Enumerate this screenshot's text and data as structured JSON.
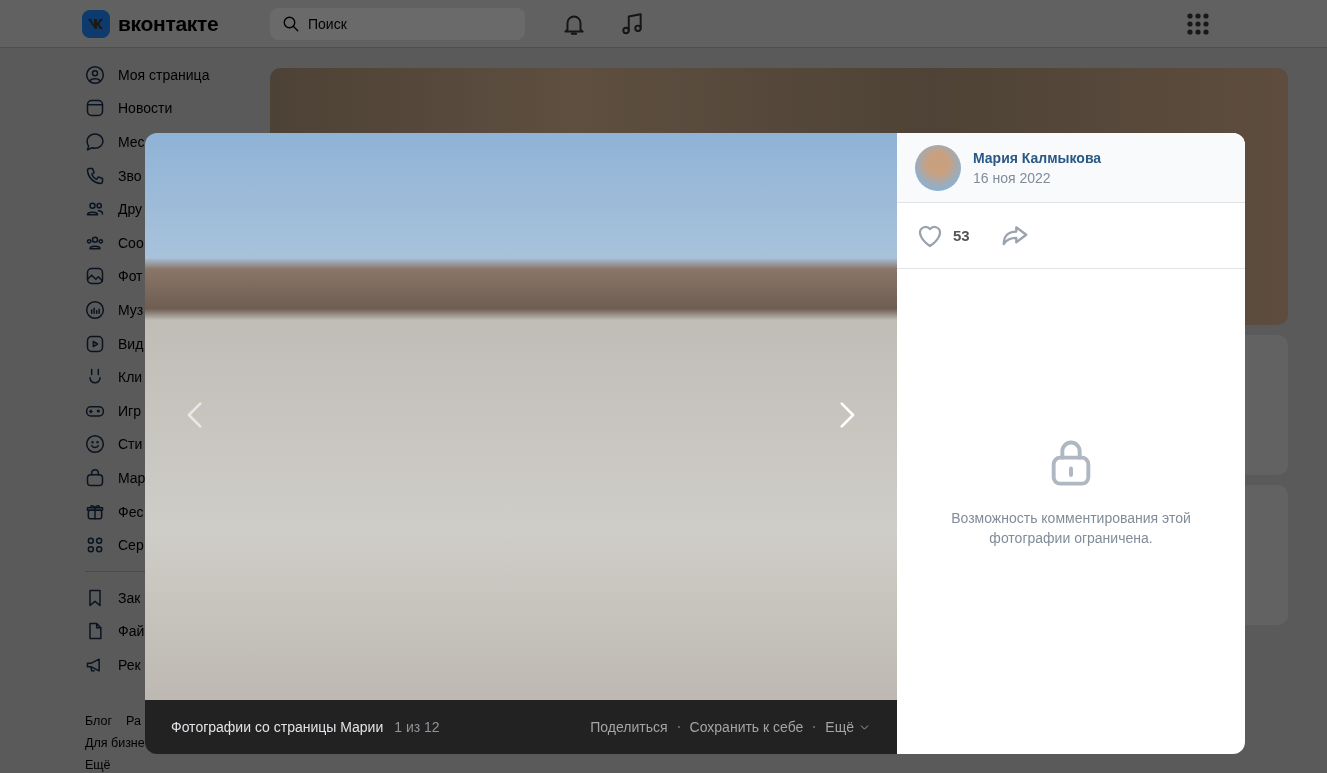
{
  "header": {
    "logo_text": "вконтакте",
    "search": {
      "placeholder": "Поиск"
    }
  },
  "sidebar": {
    "items": [
      {
        "label": "Моя страница"
      },
      {
        "label": "Новости"
      },
      {
        "label": "Мес"
      },
      {
        "label": "Зво"
      },
      {
        "label": "Дру"
      },
      {
        "label": "Соо"
      },
      {
        "label": "Фот"
      },
      {
        "label": "Муз"
      },
      {
        "label": "Вид"
      },
      {
        "label": "Кли"
      },
      {
        "label": "Игр"
      },
      {
        "label": "Сти"
      },
      {
        "label": "Мар"
      },
      {
        "label": "Фес"
      },
      {
        "label": "Сер"
      }
    ],
    "extra_items": [
      {
        "label": "Зак"
      },
      {
        "label": "Фай"
      },
      {
        "label": "Рек"
      }
    ],
    "footer_links": [
      "Блог",
      "Ра",
      "Для бизне",
      "Ещё"
    ]
  },
  "photo_viewer": {
    "author": {
      "name": "Мария Калмыкова",
      "date": "16 ноя 2022"
    },
    "likes": "53",
    "comment_notice": "Возможность комментирования этой фотографии ограничена.",
    "album": "Фотографии со страницы Марии",
    "counter": "1 из 12",
    "actions": [
      "Поделиться",
      "Сохранить к себе",
      "Ещё"
    ]
  }
}
